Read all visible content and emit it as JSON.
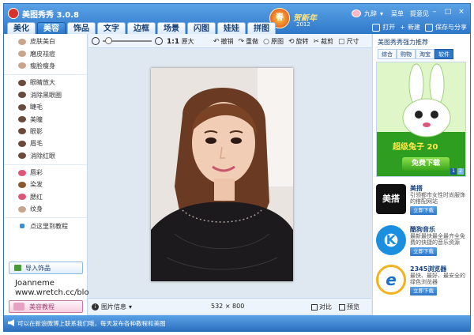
{
  "app": {
    "title": "美图秀秀 3.0.8"
  },
  "titlebar": {
    "spring_badge": "春",
    "newyear_text": "贺新年",
    "newyear_year": "2012",
    "user_name": "九辞",
    "menu_label": "菜单",
    "feedback_label": "提意见",
    "minimize": "–",
    "maximize": "□",
    "close": "×"
  },
  "tabs": [
    {
      "label": "美化",
      "active": false
    },
    {
      "label": "美容",
      "active": true
    },
    {
      "label": "饰品",
      "active": false
    },
    {
      "label": "文字",
      "active": false
    },
    {
      "label": "边框",
      "active": false
    },
    {
      "label": "场景",
      "active": false
    },
    {
      "label": "闪图",
      "active": false
    },
    {
      "label": "娃娃",
      "active": false
    },
    {
      "label": "拼图",
      "active": false
    }
  ],
  "actions": {
    "open": "打开",
    "new": "新建",
    "save_share": "保存与分享"
  },
  "left_menu": {
    "group1": [
      "皮肤美白",
      "磨皮祛痘",
      "瘦脸瘦身"
    ],
    "group2": [
      "眼睛放大",
      "消除黑眼圈",
      "睫毛",
      "美瞳",
      "眼影",
      "眉毛",
      "消除红眼"
    ],
    "group3": [
      "唇彩",
      "染发",
      "腮红",
      "纹身"
    ],
    "group4": [
      "点这里到教程"
    ],
    "import_label": "导入饰品",
    "tutorial_label": "美容教程"
  },
  "watermark": {
    "name": "Joanneme",
    "url": "www.wretch.cc/blog/joanneme"
  },
  "toolbar": {
    "zoom_ratio": "1:1",
    "zoom_label": "原大",
    "zoom_level": 0.05,
    "undo": "撤销",
    "redo": "重做",
    "original": "原图",
    "rotate": "旋转",
    "crop": "裁剪",
    "size": "尺寸"
  },
  "status": {
    "image_info": "图片信息",
    "image_size": "532 × 800",
    "compare": "对比",
    "preview": "预览"
  },
  "right_panel": {
    "title": "美图秀秀强力推荐",
    "tabs": [
      {
        "label": "综合",
        "active": false
      },
      {
        "label": "购物",
        "active": false
      },
      {
        "label": "淘宝",
        "active": false
      },
      {
        "label": "软件",
        "active": true
      }
    ],
    "ad": {
      "title": "超级兔子 20",
      "button": "免费下载",
      "pages": [
        "1",
        "2"
      ]
    },
    "recommendations": [
      {
        "name": "美搭",
        "desc": "引领都市女性时尚服饰的搭配网站",
        "button": "立即下载",
        "logo_text": "美搭"
      },
      {
        "name": "酷狗音乐",
        "desc": "最新最快最全最齐全免费的快捷的音乐资源",
        "button": "立即下载",
        "logo_text": "K"
      },
      {
        "name": "2345浏览器",
        "desc": "最快、最好、最安全的绿色浏览器",
        "button": "立即下载",
        "logo_text": "e"
      }
    ]
  },
  "bottom_bar": {
    "text": "可以在新浪微博上联系我们哦，每天发布各种教程和美图"
  },
  "colors": {
    "accent": "#2f78c9",
    "title_bar": "#5aa2e6",
    "ad_green": "#37a41c"
  }
}
